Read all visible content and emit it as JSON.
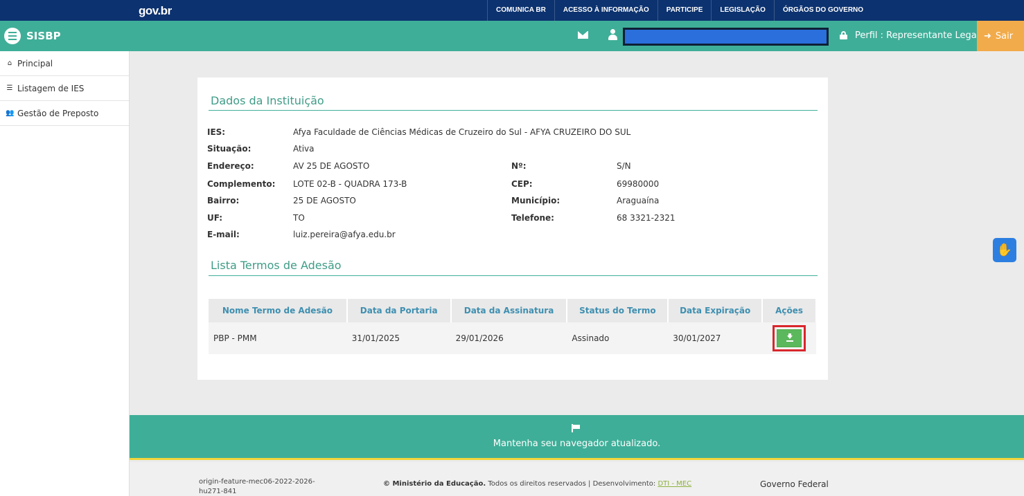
{
  "govbar": {
    "logo": "gov.br",
    "links": [
      "COMUNICA BR",
      "ACESSO À INFORMAÇÃO",
      "PARTICIPE",
      "LEGISLAÇÃO",
      "ÓRGÃOS DO GOVERNO"
    ]
  },
  "header": {
    "brand": "SISBP",
    "perfil": "Perfil : Representante Legal",
    "sair": "Sair",
    "colors": {
      "primary": "#3fae98",
      "sair": "#f2ab4a",
      "govbar": "#0c326f"
    }
  },
  "sidebar": {
    "items": [
      {
        "icon": "home-icon",
        "label": "Principal"
      },
      {
        "icon": "list-icon",
        "label": "Listagem de IES"
      },
      {
        "icon": "users-icon",
        "label": "Gestão de Preposto"
      }
    ]
  },
  "institution": {
    "title": "Dados da Instituição",
    "fields": {
      "ies_label": "IES:",
      "ies": "Afya Faculdade de Ciências Médicas de Cruzeiro do Sul - AFYA CRUZEIRO DO SUL",
      "situacao_label": "Situação:",
      "situacao": "Ativa",
      "endereco_label": "Endereço:",
      "endereco": "AV 25 DE AGOSTO",
      "numero_label": "Nº:",
      "numero": "S/N",
      "complemento_label": "Complemento:",
      "complemento": "LOTE 02-B - QUADRA 173-B",
      "cep_label": "CEP:",
      "cep": "69980000",
      "bairro_label": "Bairro:",
      "bairro": "25 DE AGOSTO",
      "municipio_label": "Município:",
      "municipio": "Araguaína",
      "uf_label": "UF:",
      "uf": "TO",
      "telefone_label": "Telefone:",
      "telefone": "68 3321-2321",
      "email_label": "E-mail:",
      "email": "luiz.pereira@afya.edu.br"
    }
  },
  "terms": {
    "title": "Lista Termos de Adesão",
    "columns": [
      "Nome Termo de Adesão",
      "Data da Portaria",
      "Data da Assinatura",
      "Status do Termo",
      "Data Expiração",
      "Ações"
    ],
    "rows": [
      [
        "PBP - PMM",
        "31/01/2025",
        "29/01/2026",
        "Assinado",
        "30/01/2027"
      ]
    ]
  },
  "footer": {
    "message": "Mantenha seu navegador atualizado.",
    "version": "origin-feature-mec06-2022-2026-hu271-841",
    "copyright": "© Ministério da Educação.",
    "rights": " Todos os direitos reservados | Desenvolvimento: ",
    "dti": "DTI - MEC",
    "gov": "Governo Federal"
  }
}
